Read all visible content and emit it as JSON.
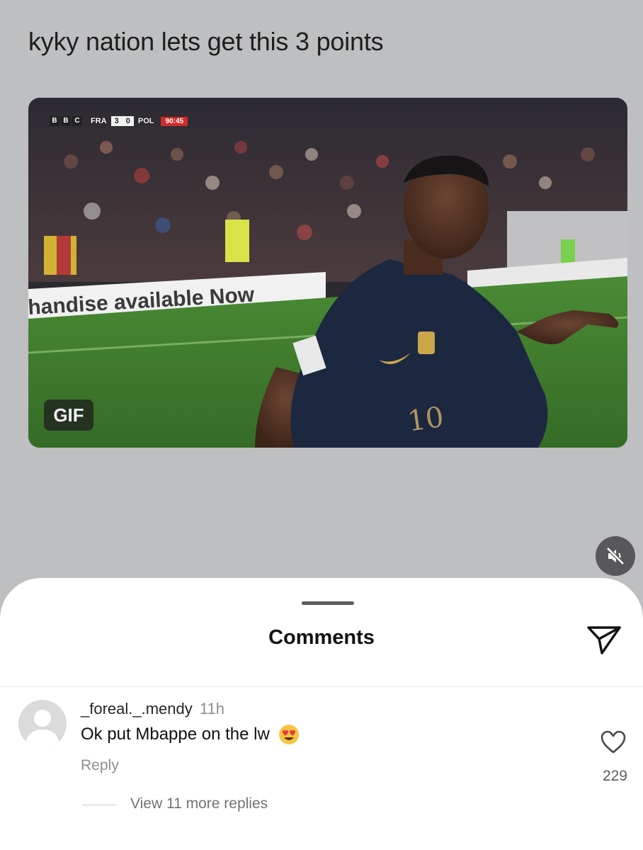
{
  "post": {
    "caption": "kyky nation lets get this 3 points",
    "media": {
      "badge": "GIF",
      "scoreboard": {
        "broadcaster": [
          "B",
          "B",
          "C"
        ],
        "home_team": "FRA",
        "home_score": "3",
        "away_score": "0",
        "away_team": "POL",
        "match_time": "90:45"
      },
      "advertising_board": "handise available Now",
      "jersey_number": "10"
    },
    "mute_icon": "speaker-muted-icon"
  },
  "comments_sheet": {
    "title": "Comments",
    "send_icon": "paper-plane-icon",
    "comments": [
      {
        "author": "_foreal._.mendy",
        "time": "11h",
        "text": "Ok put Mbappe on the lw",
        "emoji": "smiling-face-with-heart-eyes",
        "reply_label": "Reply",
        "like_icon": "heart-outline-icon",
        "likes": "229",
        "view_replies_label": "View 11 more replies"
      }
    ]
  },
  "colors": {
    "backdrop": "#bebfc1",
    "sheet": "#ffffff",
    "text_primary": "#111111",
    "text_secondary": "#8e8e8e",
    "jersey_navy": "#1c2740",
    "pitch_green": "#3f7a2c"
  }
}
